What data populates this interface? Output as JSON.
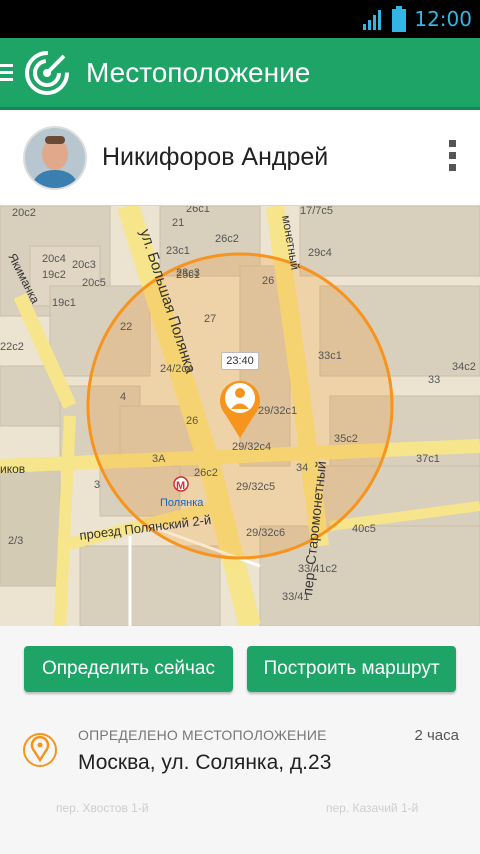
{
  "status": {
    "time": "12:00"
  },
  "appbar": {
    "title": "Местоположение"
  },
  "profile": {
    "name": "Никифоров Андрей"
  },
  "map": {
    "pin_time": "23:40",
    "streets": [
      "ул. Большая Полянка",
      "пер. Старомонетный",
      "проезд Полянский 2-й",
      "Якиманка",
      "Полянка",
      "монетный",
      "иков"
    ],
    "buildings": [
      "20c2",
      "26c1",
      "23c1",
      "20c4",
      "20c3",
      "19c2",
      "20c5",
      "19c1",
      "23c3",
      "25c1",
      "26c2",
      "21",
      "29c4",
      "17/7c5",
      "26",
      "27",
      "22",
      "22c2",
      "24/2c4",
      "33c1",
      "33",
      "34c2",
      "4",
      "26",
      "29/32c1",
      "29/32c4",
      "35c2",
      "34",
      "3А",
      "26c2",
      "37c1",
      "3",
      "29/32c5",
      "29/32c6",
      "40c5",
      "2/3",
      "33/41c2",
      "33/41"
    ],
    "metro_label": "М"
  },
  "actions": {
    "locate_now": "Определить сейчас",
    "build_route": "Построить маршрут"
  },
  "location": {
    "label": "ОПРЕДЕЛЕНО МЕСТОПОЛОЖЕНИЕ",
    "ago": "2 часа",
    "address": "Москва, ул. Солянка, д.23"
  },
  "faded": {
    "street1": "пер. Хвостов 1-й",
    "street2": "пер. Казачий 1-й"
  },
  "colors": {
    "accent": "#1fa468",
    "pin": "#f7941d",
    "status_icons": "#33b5e5"
  }
}
